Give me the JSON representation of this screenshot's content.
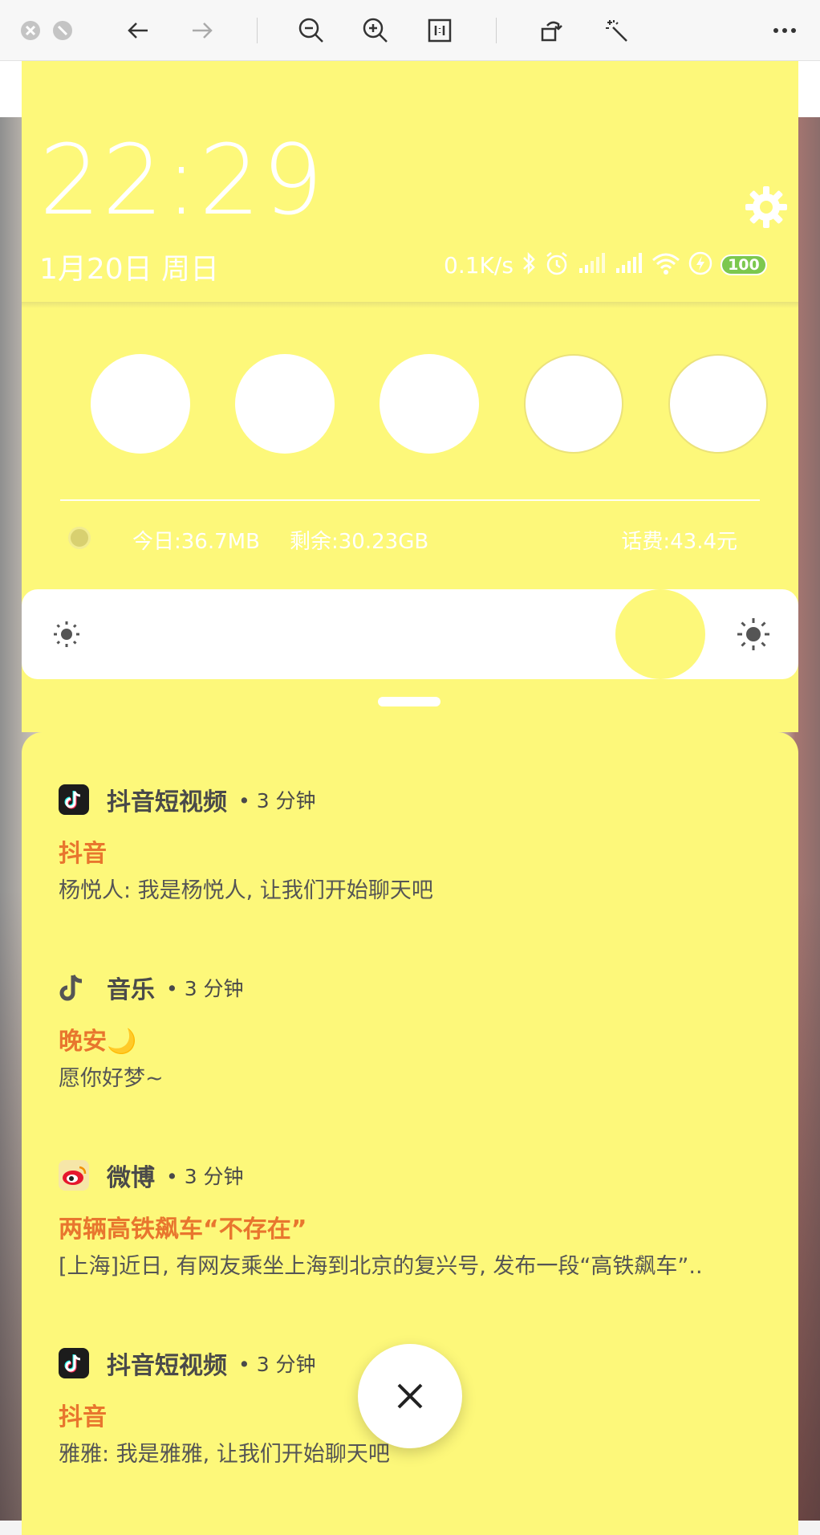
{
  "statusbar": {
    "time": "22:29",
    "date": "1月20日 周日",
    "net_speed": "0.1K/s",
    "battery": "100"
  },
  "data_usage": {
    "today": "今日:36.7MB",
    "remaining": "剩余:30.23GB",
    "fee": "话费:43.4元"
  },
  "notifications": [
    {
      "icon": "douyin-icon",
      "app": "抖音短视频",
      "time": "• 3 分钟",
      "title": "抖音",
      "body": "杨悦人: 我是杨悦人, 让我们开始聊天吧"
    },
    {
      "icon": "music-note-icon",
      "app": "音乐",
      "time": "• 3 分钟",
      "title": "晚安🌙",
      "body": "愿你好梦~"
    },
    {
      "icon": "weibo-icon",
      "app": "微博",
      "time": "• 3 分钟",
      "title": "两辆高铁飙车“不存在”",
      "body": "[上海]近日, 有网友乘坐上海到北京的复兴号, 发布一段“高铁飙车”.."
    },
    {
      "icon": "douyin-icon",
      "app": "抖音短视频",
      "time": "• 3 分钟",
      "title": "抖音",
      "body": "雅雅: 我是雅雅, 让我们开始聊天吧"
    }
  ],
  "colors": {
    "panel": "#fdf87a",
    "title_accent": "#e8762e",
    "battery": "#7cc84e"
  }
}
